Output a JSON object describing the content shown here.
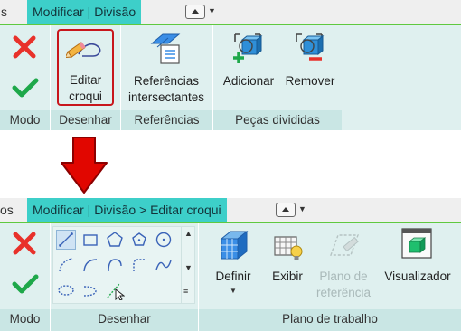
{
  "top": {
    "tab_left": "s",
    "tab_active": "Modificar | Divisão",
    "panels": {
      "modo": "Modo",
      "desenhar": "Desenhar",
      "referencias": "Referências",
      "pecas": "Peças divididas"
    },
    "buttons": {
      "editar_line1": "Editar",
      "editar_line2": "croqui",
      "ref_line1": "Referências",
      "ref_line2": "intersectantes",
      "adicionar": "Adicionar",
      "remover": "Remover"
    }
  },
  "bottom": {
    "tab_left": "os",
    "tab_active": "Modificar | Divisão > Editar croqui",
    "panels": {
      "modo": "Modo",
      "desenhar": "Desenhar",
      "plano": "Plano de trabalho"
    },
    "buttons": {
      "definir": "Definir",
      "exibir": "Exibir",
      "plano_line1": "Plano de",
      "plano_line2": "referência",
      "visualizador": "Visualizador"
    }
  },
  "colors": {
    "tab_active": "#3dcfc9",
    "tab_line": "#5fc93f",
    "ribbon_bg": "#dff0ef",
    "panel_bar": "#c9e6e4",
    "cancel_red": "#e8312a",
    "finish_green": "#1ea84a",
    "highlight_border": "#c8161c",
    "arrow_red": "#e10600"
  }
}
